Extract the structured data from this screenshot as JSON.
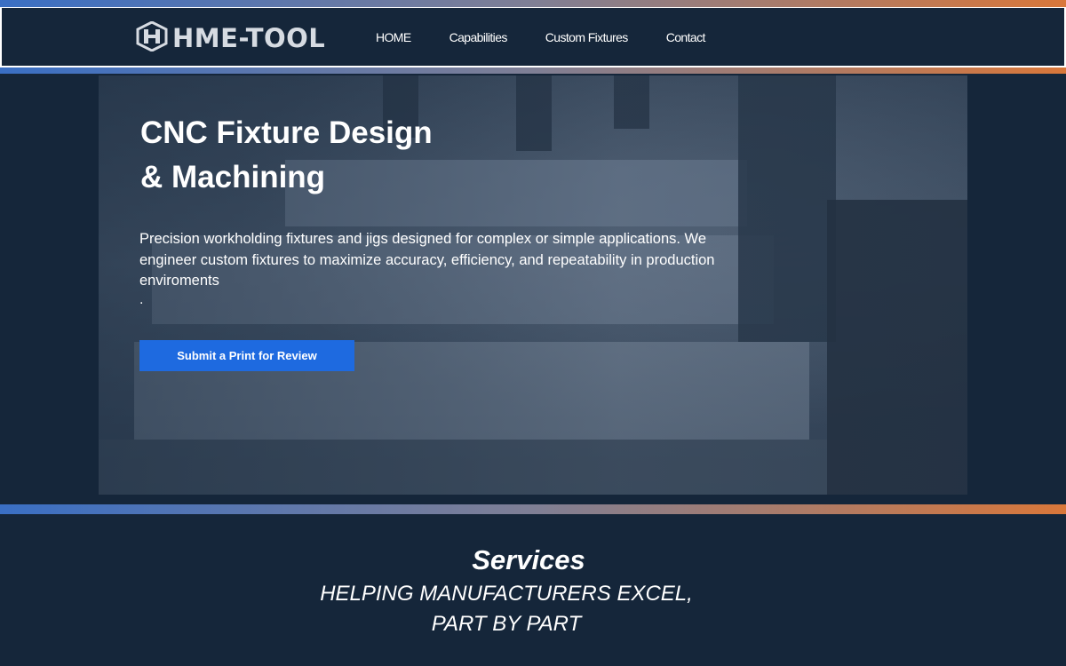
{
  "brand": {
    "logo_text": "HME-TOOL"
  },
  "nav": {
    "items": [
      {
        "label": "HOME"
      },
      {
        "label": "Capabilities"
      },
      {
        "label": "Custom Fixtures"
      },
      {
        "label": "Contact"
      }
    ]
  },
  "hero": {
    "title_line1": "CNC Fixture Design",
    "title_line2": "& Machining",
    "description": "Precision workholding fixtures and jigs designed for complex or simple applications. We engineer custom fixtures to maximize accuracy, efficiency, and repeatability in production enviroments",
    "trailing_dot": ".",
    "cta_label": "Submit a Print for Review"
  },
  "services": {
    "title": "Services",
    "subtitle_line1": "HELPING MANUFACTURERS EXCEL,",
    "subtitle_line2": "PART BY PART"
  },
  "colors": {
    "background": "#15263a",
    "accent_blue": "#1e6ae0",
    "gradient_start": "#3a6fc4",
    "gradient_end": "#d9773a"
  }
}
